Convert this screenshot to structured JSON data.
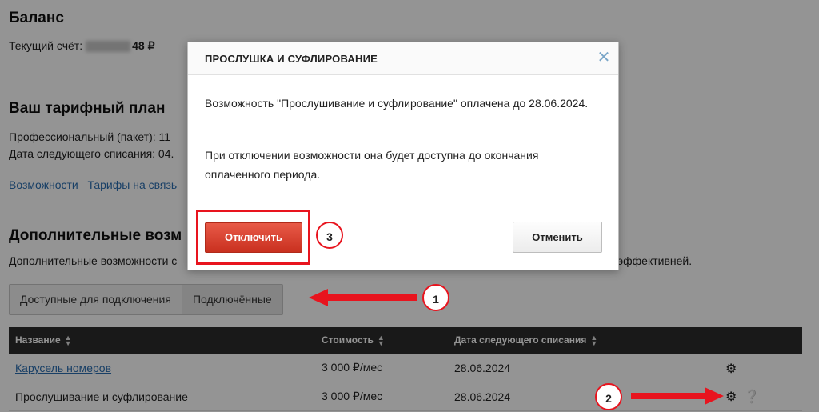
{
  "balance": {
    "heading": "Баланс",
    "account_label": "Текущий счёт:",
    "amount_visible": "48 ₽"
  },
  "tariff": {
    "heading": "Ваш тарифный план",
    "plan_line": "Профессиональный (пакет):  11",
    "next_charge_line": "Дата следующего списания: 04.",
    "link_features": "Возможности",
    "link_rates": "Тарифы на связь"
  },
  "addons": {
    "heading": "Дополнительные возм",
    "description_left": "Дополнительные возможности с",
    "description_right": "эффективней."
  },
  "tabs": {
    "available": "Доступные для подключения",
    "connected": "Подключённые"
  },
  "table": {
    "headers": [
      "Название",
      "Стоимость",
      "Дата следующего списания"
    ],
    "rows": [
      {
        "name": "Карусель номеров",
        "cost": "3 000 ₽/мес",
        "date": "28.06.2024"
      },
      {
        "name": "Прослушивание и суфлирование",
        "cost": "3 000 ₽/мес",
        "date": "28.06.2024"
      }
    ]
  },
  "modal": {
    "title": "ПРОСЛУШКА И СУФЛИРОВАНИЕ",
    "close_glyph": "✕",
    "paragraph1": "Возможность \"Прослушивание и суфлирование\" оплачена до 28.06.2024.",
    "paragraph2": "При отключении возможности она будет доступна до окончания оплаченного периода.",
    "disable_button": "Отключить",
    "cancel_button": "Отменить"
  },
  "annotations": {
    "step1": "1",
    "step2": "2",
    "step3": "3",
    "accent_color": "#e8141e"
  },
  "icons": {
    "gear": "gear-icon",
    "help": "question-icon",
    "sort": "sort-arrows-icon"
  }
}
